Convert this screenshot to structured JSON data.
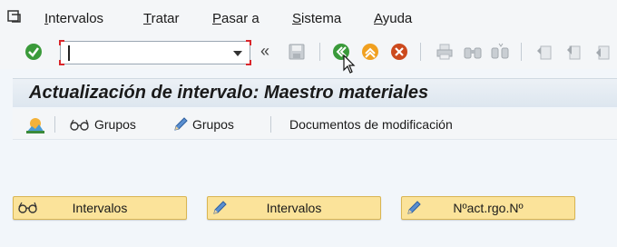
{
  "menu": {
    "items": [
      {
        "label": "Intervalos"
      },
      {
        "label": "Tratar"
      },
      {
        "label": "Pasar a"
      },
      {
        "label": "Sistema"
      },
      {
        "label": "Ayuda"
      }
    ]
  },
  "toolbar": {
    "command_field_value": ""
  },
  "title": "Actualización de intervalo: Maestro materiales",
  "app_toolbar": {
    "groups_display_label": "Grupos",
    "groups_change_label": "Grupos",
    "change_docs_label": "Documentos de modificación"
  },
  "buttons": {
    "intervals_display_label": "Intervalos",
    "intervals_change_label": "Intervalos",
    "current_number_label": "Nºact.rgo.Nº"
  }
}
